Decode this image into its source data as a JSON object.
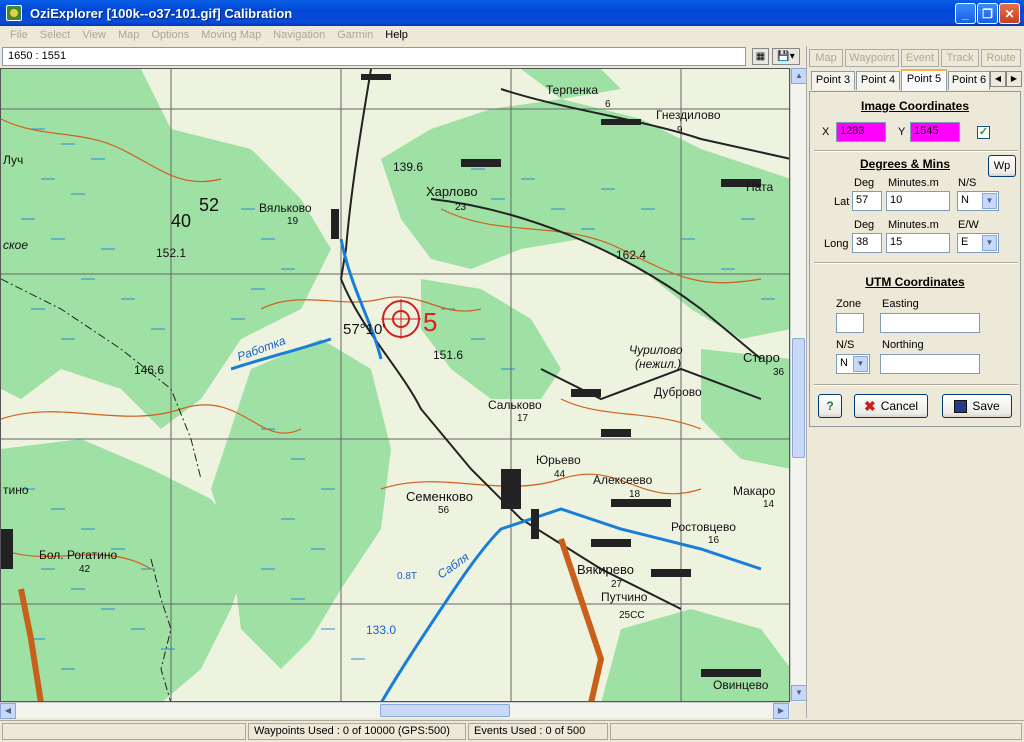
{
  "window": {
    "title": "OziExplorer [100k--o37-101.gif] Calibration",
    "controls": [
      "minimize-icon",
      "maximize-icon",
      "close-icon"
    ]
  },
  "menu": [
    "File",
    "Select",
    "View",
    "Map",
    "Options",
    "Moving Map",
    "Navigation",
    "Garmin",
    "Help"
  ],
  "coord_display": "1650 : 1551",
  "toolbar_icons": [
    "map-image-icon",
    "save-dropdown-icon"
  ],
  "top_tabs": [
    "Map",
    "Waypoint",
    "Event",
    "Track",
    "Route"
  ],
  "point_tabs": [
    "Point 3",
    "Point 4",
    "Point 5",
    "Point 6"
  ],
  "selected_point_tab": "Point 5",
  "image_coordinates": {
    "title": "Image Coordinates",
    "x_label": "X",
    "x_value": "1283",
    "y_label": "Y",
    "y_value": "1545",
    "checked": true
  },
  "degrees_mins": {
    "title": "Degrees & Mins",
    "wp_label": "Wp",
    "deg_label": "Deg",
    "minutes_label": "Minutes.m",
    "ns_label": "N/S",
    "ew_label": "E/W",
    "lat_label": "Lat",
    "lat_deg": "57",
    "lat_min": "10",
    "lat_ns": "N",
    "long_label": "Long",
    "long_deg": "38",
    "long_min": "15",
    "long_ew": "E"
  },
  "utm": {
    "title": "UTM Coordinates",
    "zone_label": "Zone",
    "zone_value": "",
    "easting_label": "Easting",
    "easting_value": "",
    "ns_label": "N/S",
    "ns_value": "N",
    "northing_label": "Northing",
    "northing_value": ""
  },
  "buttons": {
    "help": "?",
    "cancel": "Cancel",
    "save": "Save"
  },
  "status": {
    "waypoints": "Waypoints Used : 0 of 10000  (GPS:500)",
    "events": "Events Used : 0 of 500"
  },
  "map_labels": {
    "places": [
      "Терпенка",
      "Гнездилово",
      "Харлово",
      "Вяльково",
      "Ната",
      "Чурилово",
      "(нежил.)",
      "Дуброво",
      "Старо",
      "Сальково",
      "Юрьево",
      "Алексеево",
      "Семенково",
      "Макаро",
      "Ростовцево",
      "Бол. Рогатино",
      "Вякирево",
      "Путчино",
      "Овинцево",
      "Работка",
      "Сабля",
      "Луч",
      "тино",
      "ское"
    ],
    "numbers": [
      "139.6",
      "40",
      "52",
      "152.1",
      "162.4",
      "57°10'",
      "151.6",
      "146.6",
      "133.0",
      "23",
      "19",
      "6",
      "9",
      "17",
      "44",
      "18",
      "56",
      "42",
      "27",
      "25СС",
      "16",
      "14",
      "36",
      "0.8Т"
    ],
    "marker": "5"
  }
}
